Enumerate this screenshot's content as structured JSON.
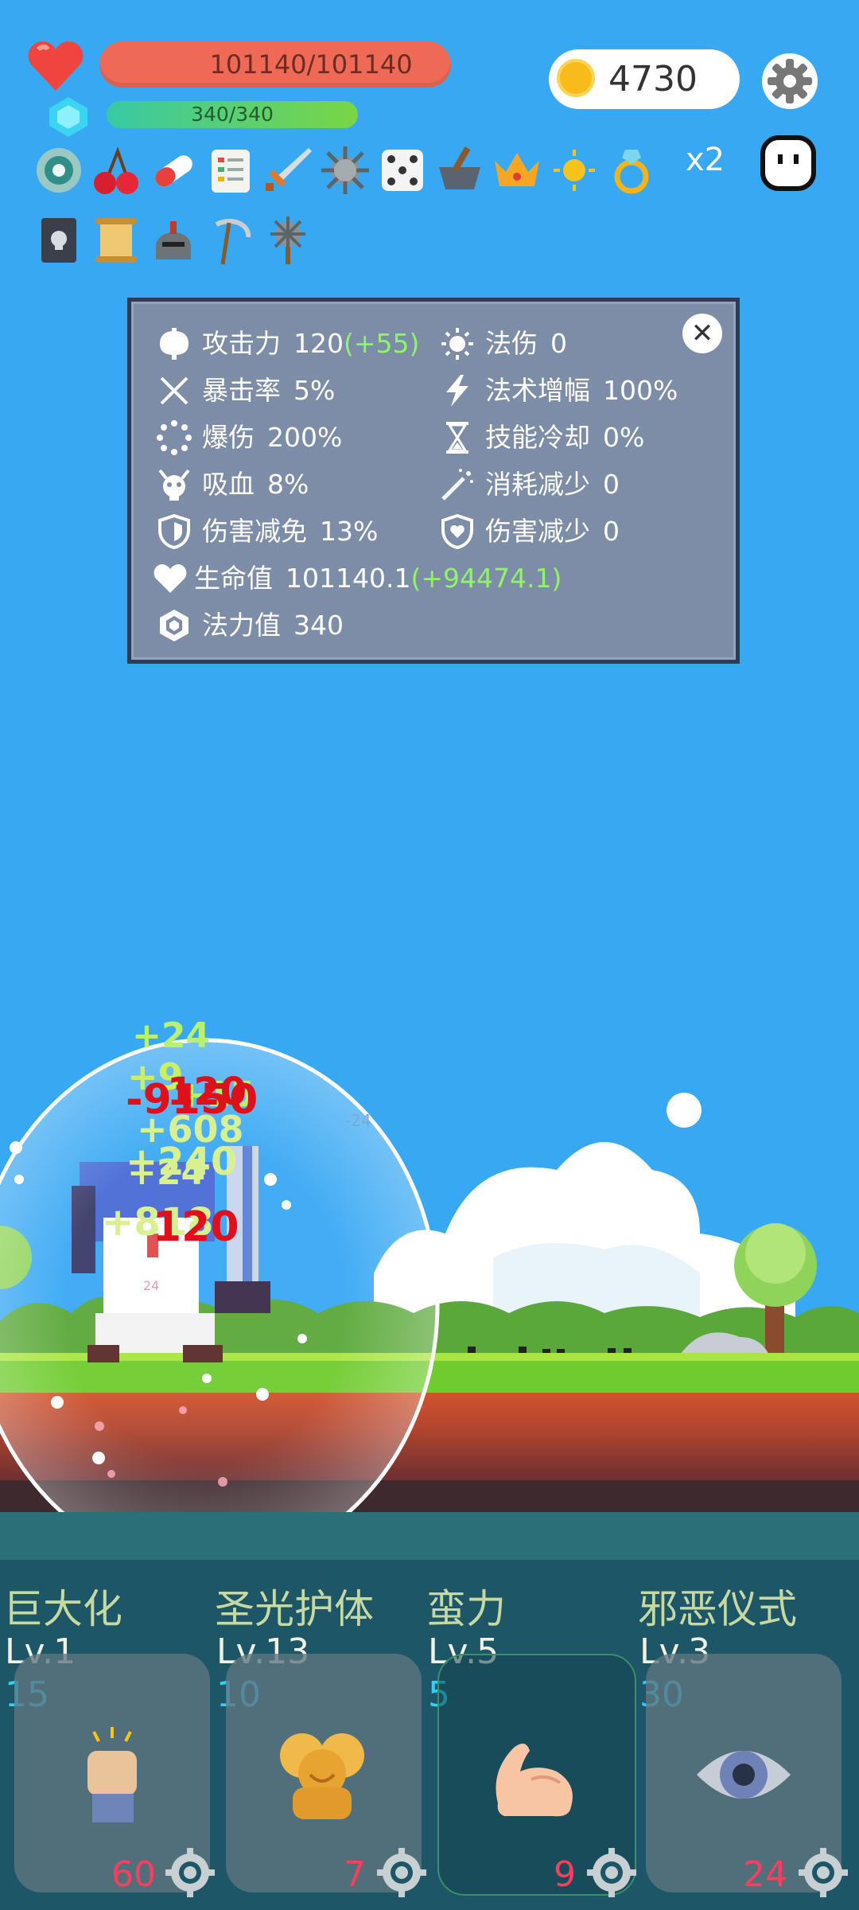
{
  "hud": {
    "hp_text": "101140/101140",
    "hp_fraction": 1.0,
    "mp_text": "340/340",
    "mp_fraction": 1.0,
    "coins": "4730",
    "multiplier": "x2"
  },
  "icons": {
    "heart": "heart-icon",
    "gem": "gem-icon",
    "coin": "coin-icon",
    "settings": "gear-icon",
    "ghost": "ghost-icon"
  },
  "items_row1": [
    "target-icon",
    "cherry-icon",
    "pill-icon",
    "notepad-icon",
    "sword-icon",
    "spiked-ball-icon",
    "dice-icon",
    "mortar-icon",
    "crown-icon",
    "sun-icon",
    "ring-icon"
  ],
  "items_row2": [
    "skull-book-icon",
    "scroll-icon",
    "helmet-icon",
    "scythe-icon",
    "mace-icon"
  ],
  "stats": {
    "left": [
      {
        "name": "攻击力",
        "value": "120",
        "bonus": "(+55)",
        "icon": "axe-icon"
      },
      {
        "name": "暴击率",
        "value": "5%",
        "bonus": "",
        "icon": "crossed-swords-icon"
      },
      {
        "name": "爆伤",
        "value": "200%",
        "bonus": "",
        "icon": "burst-icon"
      },
      {
        "name": "吸血",
        "value": "8%",
        "bonus": "",
        "icon": "demon-skull-icon"
      },
      {
        "name": "伤害减免",
        "value": "13%",
        "bonus": "",
        "icon": "shield-icon"
      },
      {
        "name": "生命值",
        "value": "101140.1",
        "bonus": "(+94474.1)",
        "icon": "heart-icon"
      },
      {
        "name": "法力值",
        "value": "340",
        "bonus": "",
        "icon": "crystal-icon"
      }
    ],
    "right": [
      {
        "name": "法伤",
        "value": "0",
        "icon": "sun-icon"
      },
      {
        "name": "法术增幅",
        "value": "100%",
        "icon": "lightning-icon"
      },
      {
        "name": "技能冷却",
        "value": "0%",
        "icon": "hourglass-icon"
      },
      {
        "name": "消耗减少",
        "value": "0",
        "icon": "magic-wand-icon"
      },
      {
        "name": "伤害减少",
        "value": "0",
        "icon": "heart-shield-icon"
      }
    ],
    "close_icon": "close-icon"
  },
  "damage_numbers": {
    "green": [
      "+24",
      "+9",
      "+15",
      "+608",
      "+240",
      "+24",
      "+818"
    ],
    "red": [
      "-9150",
      "120",
      "120"
    ],
    "small": [
      "-24",
      "24"
    ]
  },
  "skills": [
    {
      "name": "巨大化",
      "level": "Lv.1",
      "cost": "15",
      "cooldown": "60",
      "icon": "fist-icon"
    },
    {
      "name": "圣光护体",
      "level": "Lv.13",
      "cost": "10",
      "cooldown": "7",
      "icon": "golden-angels-icon"
    },
    {
      "name": "蛮力",
      "level": "Lv.5",
      "cost": "5",
      "cooldown": "9",
      "icon": "bicep-icon"
    },
    {
      "name": "邪恶仪式",
      "level": "Lv.3",
      "cost": "30",
      "cooldown": "24",
      "icon": "eye-icon"
    }
  ]
}
